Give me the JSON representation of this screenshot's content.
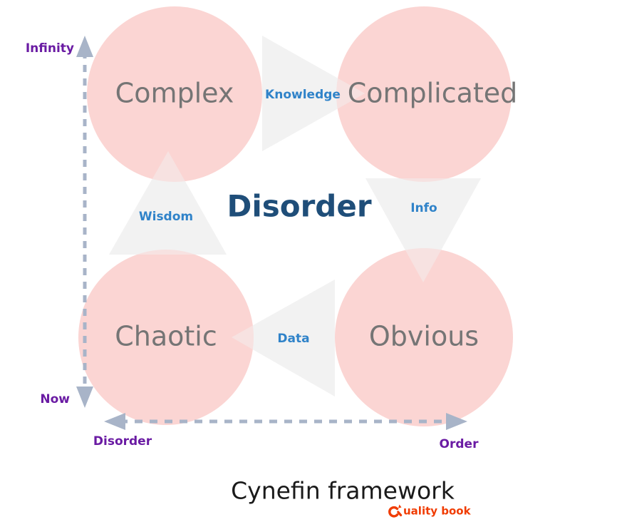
{
  "title": "Cynefin framework",
  "colors": {
    "circle_fill": "#FBD5D3",
    "triangle_fill": "#F2F2F2",
    "circle_label": "#757575",
    "triangle_label": "#3083C9",
    "center_label": "#1F4E79",
    "axis_line": "#A8B4C8",
    "axis_label": "#6A1BA3",
    "title": "#1a1a1a",
    "logo": "#F03C02",
    "background": "#FFFFFF"
  },
  "domains": {
    "complex": "Complex",
    "complicated": "Complicated",
    "chaotic": "Chaotic",
    "obvious": "Obvious"
  },
  "center": {
    "disorder": "Disorder"
  },
  "transitions": {
    "knowledge": "Knowledge",
    "wisdom": "Wisdom",
    "info": "Info",
    "data": "Data"
  },
  "axes": {
    "vertical": {
      "top_label": "Infinity",
      "bottom_label": "Now"
    },
    "horizontal": {
      "left_label": "Disorder",
      "right_label": "Order"
    }
  },
  "logo": {
    "mark": "Q",
    "text": "uality book"
  }
}
